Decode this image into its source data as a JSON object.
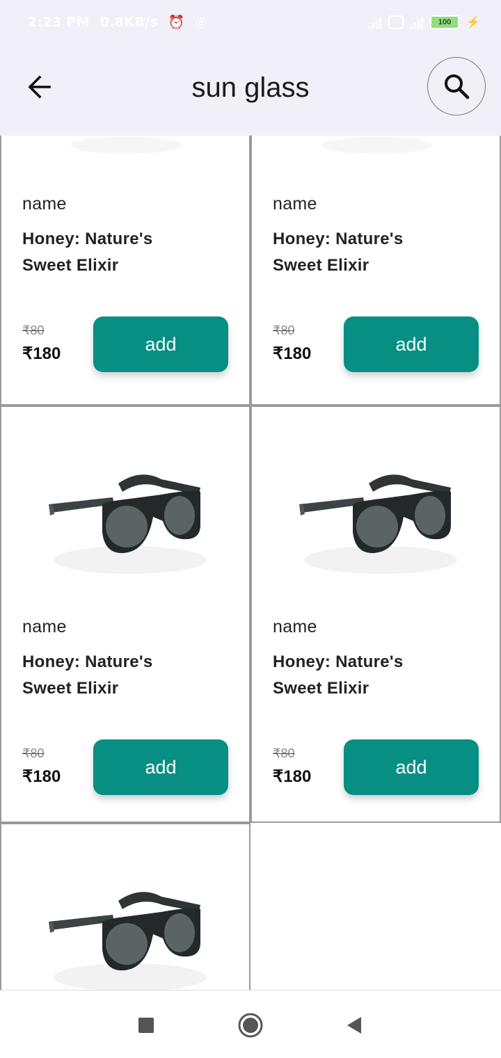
{
  "status_bar": {
    "time": "2:23 PM",
    "speed": "0.8KB/s",
    "battery": "100",
    "icons": [
      "alarm-icon",
      "vpn-icon",
      "signal-icon",
      "wifi-icon",
      "battery-icon",
      "charging-icon"
    ]
  },
  "header": {
    "title": "sun glass",
    "back_icon": "arrow-left-icon",
    "search_icon": "search-icon"
  },
  "products": [
    {
      "name_label": "name",
      "title": "Honey: Nature's Sweet Elixir",
      "old_price": "₹80",
      "price": "₹180",
      "add_label": "add"
    },
    {
      "name_label": "name",
      "title": "Honey: Nature's Sweet Elixir",
      "old_price": "₹80",
      "price": "₹180",
      "add_label": "add"
    },
    {
      "name_label": "name",
      "title": "Honey: Nature's Sweet Elixir",
      "old_price": "₹80",
      "price": "₹180",
      "add_label": "add"
    },
    {
      "name_label": "name",
      "title": "Honey: Nature's Sweet Elixir",
      "old_price": "₹80",
      "price": "₹180",
      "add_label": "add"
    },
    {
      "name_label": "",
      "title": "",
      "old_price": "",
      "price": "",
      "add_label": ""
    }
  ],
  "nav": {
    "icons": [
      "recents-square-icon",
      "home-circle-icon",
      "back-triangle-icon"
    ]
  },
  "colors": {
    "accent": "#088f84",
    "app_bar": "#f1eff7",
    "card_border": "#9a9a9a"
  }
}
